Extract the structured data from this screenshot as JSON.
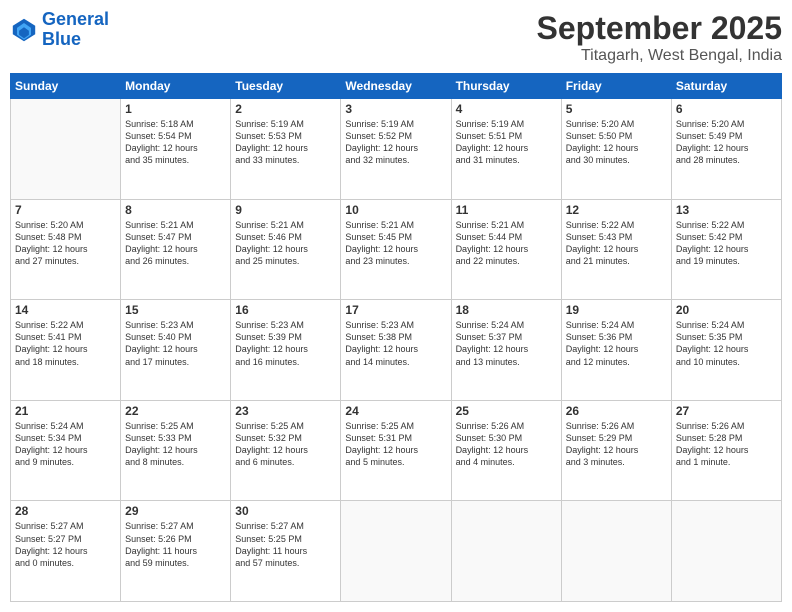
{
  "header": {
    "logo_line1": "General",
    "logo_line2": "Blue",
    "month": "September 2025",
    "location": "Titagarh, West Bengal, India"
  },
  "weekdays": [
    "Sunday",
    "Monday",
    "Tuesday",
    "Wednesday",
    "Thursday",
    "Friday",
    "Saturday"
  ],
  "weeks": [
    [
      {
        "day": "",
        "info": ""
      },
      {
        "day": "1",
        "info": "Sunrise: 5:18 AM\nSunset: 5:54 PM\nDaylight: 12 hours\nand 35 minutes."
      },
      {
        "day": "2",
        "info": "Sunrise: 5:19 AM\nSunset: 5:53 PM\nDaylight: 12 hours\nand 33 minutes."
      },
      {
        "day": "3",
        "info": "Sunrise: 5:19 AM\nSunset: 5:52 PM\nDaylight: 12 hours\nand 32 minutes."
      },
      {
        "day": "4",
        "info": "Sunrise: 5:19 AM\nSunset: 5:51 PM\nDaylight: 12 hours\nand 31 minutes."
      },
      {
        "day": "5",
        "info": "Sunrise: 5:20 AM\nSunset: 5:50 PM\nDaylight: 12 hours\nand 30 minutes."
      },
      {
        "day": "6",
        "info": "Sunrise: 5:20 AM\nSunset: 5:49 PM\nDaylight: 12 hours\nand 28 minutes."
      }
    ],
    [
      {
        "day": "7",
        "info": "Sunrise: 5:20 AM\nSunset: 5:48 PM\nDaylight: 12 hours\nand 27 minutes."
      },
      {
        "day": "8",
        "info": "Sunrise: 5:21 AM\nSunset: 5:47 PM\nDaylight: 12 hours\nand 26 minutes."
      },
      {
        "day": "9",
        "info": "Sunrise: 5:21 AM\nSunset: 5:46 PM\nDaylight: 12 hours\nand 25 minutes."
      },
      {
        "day": "10",
        "info": "Sunrise: 5:21 AM\nSunset: 5:45 PM\nDaylight: 12 hours\nand 23 minutes."
      },
      {
        "day": "11",
        "info": "Sunrise: 5:21 AM\nSunset: 5:44 PM\nDaylight: 12 hours\nand 22 minutes."
      },
      {
        "day": "12",
        "info": "Sunrise: 5:22 AM\nSunset: 5:43 PM\nDaylight: 12 hours\nand 21 minutes."
      },
      {
        "day": "13",
        "info": "Sunrise: 5:22 AM\nSunset: 5:42 PM\nDaylight: 12 hours\nand 19 minutes."
      }
    ],
    [
      {
        "day": "14",
        "info": "Sunrise: 5:22 AM\nSunset: 5:41 PM\nDaylight: 12 hours\nand 18 minutes."
      },
      {
        "day": "15",
        "info": "Sunrise: 5:23 AM\nSunset: 5:40 PM\nDaylight: 12 hours\nand 17 minutes."
      },
      {
        "day": "16",
        "info": "Sunrise: 5:23 AM\nSunset: 5:39 PM\nDaylight: 12 hours\nand 16 minutes."
      },
      {
        "day": "17",
        "info": "Sunrise: 5:23 AM\nSunset: 5:38 PM\nDaylight: 12 hours\nand 14 minutes."
      },
      {
        "day": "18",
        "info": "Sunrise: 5:24 AM\nSunset: 5:37 PM\nDaylight: 12 hours\nand 13 minutes."
      },
      {
        "day": "19",
        "info": "Sunrise: 5:24 AM\nSunset: 5:36 PM\nDaylight: 12 hours\nand 12 minutes."
      },
      {
        "day": "20",
        "info": "Sunrise: 5:24 AM\nSunset: 5:35 PM\nDaylight: 12 hours\nand 10 minutes."
      }
    ],
    [
      {
        "day": "21",
        "info": "Sunrise: 5:24 AM\nSunset: 5:34 PM\nDaylight: 12 hours\nand 9 minutes."
      },
      {
        "day": "22",
        "info": "Sunrise: 5:25 AM\nSunset: 5:33 PM\nDaylight: 12 hours\nand 8 minutes."
      },
      {
        "day": "23",
        "info": "Sunrise: 5:25 AM\nSunset: 5:32 PM\nDaylight: 12 hours\nand 6 minutes."
      },
      {
        "day": "24",
        "info": "Sunrise: 5:25 AM\nSunset: 5:31 PM\nDaylight: 12 hours\nand 5 minutes."
      },
      {
        "day": "25",
        "info": "Sunrise: 5:26 AM\nSunset: 5:30 PM\nDaylight: 12 hours\nand 4 minutes."
      },
      {
        "day": "26",
        "info": "Sunrise: 5:26 AM\nSunset: 5:29 PM\nDaylight: 12 hours\nand 3 minutes."
      },
      {
        "day": "27",
        "info": "Sunrise: 5:26 AM\nSunset: 5:28 PM\nDaylight: 12 hours\nand 1 minute."
      }
    ],
    [
      {
        "day": "28",
        "info": "Sunrise: 5:27 AM\nSunset: 5:27 PM\nDaylight: 12 hours\nand 0 minutes."
      },
      {
        "day": "29",
        "info": "Sunrise: 5:27 AM\nSunset: 5:26 PM\nDaylight: 11 hours\nand 59 minutes."
      },
      {
        "day": "30",
        "info": "Sunrise: 5:27 AM\nSunset: 5:25 PM\nDaylight: 11 hours\nand 57 minutes."
      },
      {
        "day": "",
        "info": ""
      },
      {
        "day": "",
        "info": ""
      },
      {
        "day": "",
        "info": ""
      },
      {
        "day": "",
        "info": ""
      }
    ]
  ]
}
